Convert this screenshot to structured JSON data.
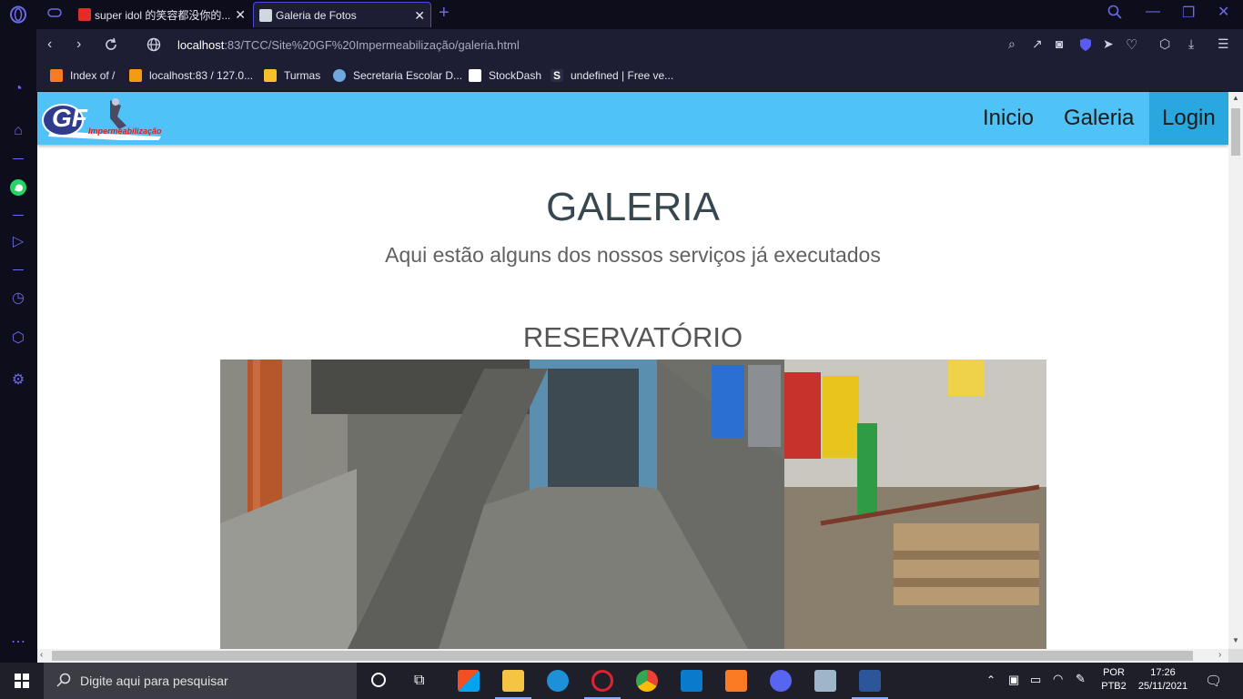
{
  "browser": {
    "tabs": [
      {
        "title": "super idol 的笑容都没你的..."
      },
      {
        "title": "Galeria de Fotos"
      }
    ],
    "url_host": "localhost",
    "url_rest": ":83/TCC/Site%20GF%20Impermeabilização/galeria.html",
    "bookmarks": [
      {
        "label": "Index of /"
      },
      {
        "label": "localhost:83 / 127.0..."
      },
      {
        "label": "Turmas"
      },
      {
        "label": "Secretaria Escolar D..."
      },
      {
        "label": "StockDash"
      },
      {
        "label": "undefined | Free ve..."
      }
    ]
  },
  "site": {
    "logo_text": "GF",
    "logo_sub": "Impermeabilização",
    "nav": [
      {
        "label": "Inicio"
      },
      {
        "label": "Galeria"
      },
      {
        "label": "Login"
      }
    ],
    "title": "GALERIA",
    "subtitle": "Aqui estão alguns dos nossos serviços já executados",
    "section_title": "RESERVATÓRIO"
  },
  "taskbar": {
    "search_placeholder": "Digite aqui para pesquisar",
    "lang_top": "POR",
    "lang_bottom": "PTB2",
    "time": "17:26",
    "date": "25/11/2021"
  },
  "colors": {
    "navbar": "#4fc3f7",
    "nav_active": "#29a8e0",
    "browser_accent": "#6b6be6"
  }
}
